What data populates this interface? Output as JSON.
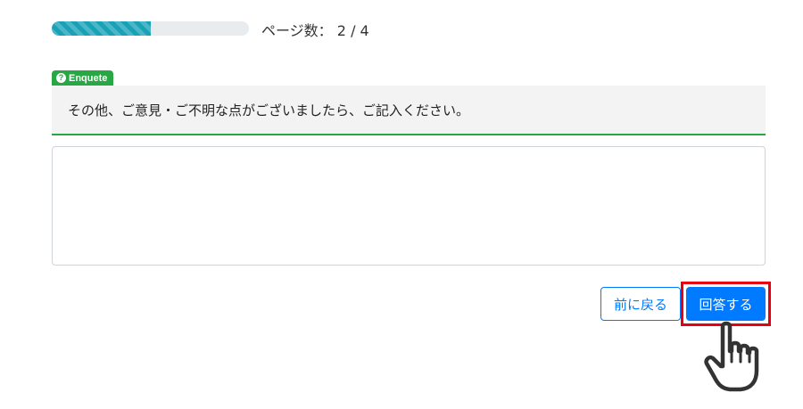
{
  "progress": {
    "fraction": 0.5,
    "label": "ページ数：",
    "current": "2",
    "separator": "/",
    "total": "4"
  },
  "question": {
    "badge_label": "Enquete",
    "badge_icon": "question-circle-icon",
    "text": "その他、ご意見・ご不明な点がございましたら、ご記入ください。"
  },
  "answer": {
    "value": "",
    "placeholder": ""
  },
  "buttons": {
    "back_label": "前に戻る",
    "submit_label": "回答する"
  },
  "colors": {
    "progress": "#17a2b8",
    "badge": "#28a745",
    "primary": "#007bff",
    "highlight": "#e60012"
  },
  "annotation": {
    "pointer_icon": "hand-pointer-icon"
  }
}
